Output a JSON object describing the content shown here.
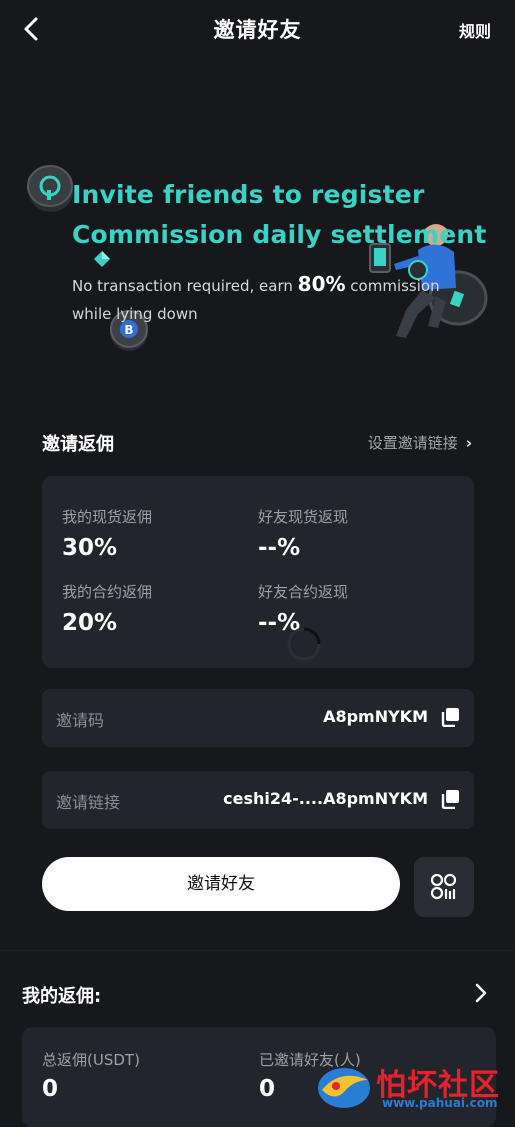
{
  "header": {
    "title": "邀请好友",
    "rules": "规则"
  },
  "hero": {
    "line1": "Invite friends to register",
    "line2": "Commission daily settlement",
    "sub_prefix": "No transaction required, earn ",
    "sub_percent": "80%",
    "sub_suffix": " commission while lying down"
  },
  "rebate_section": {
    "title": "邀请返佣",
    "link": "设置邀请链接"
  },
  "stats": {
    "my_spot_label": "我的现货返佣",
    "my_spot_value": "30%",
    "friend_spot_label": "好友现货返现",
    "friend_spot_value": "--%",
    "my_contract_label": "我的合约返佣",
    "my_contract_value": "20%",
    "friend_contract_label": "好友合约返现",
    "friend_contract_value": "--%"
  },
  "invite_code": {
    "label": "邀请码",
    "value": "A8pmNYKM"
  },
  "invite_link": {
    "label": "邀请链接",
    "value": "ceshi24-....A8pmNYKM"
  },
  "actions": {
    "invite_button": "邀请好友"
  },
  "my_rebate": {
    "title": "我的返佣:",
    "total_label": "总返佣(USDT)",
    "total_value": "0",
    "invited_label": "已邀请好友(人)",
    "invited_value": "0"
  },
  "watermark": {
    "text": "怕坏社区",
    "url": "www.pahuai.com"
  },
  "colors": {
    "background": "#17181b",
    "card": "#22252b",
    "accent": "#39d3c6",
    "muted": "#9da0a6"
  }
}
